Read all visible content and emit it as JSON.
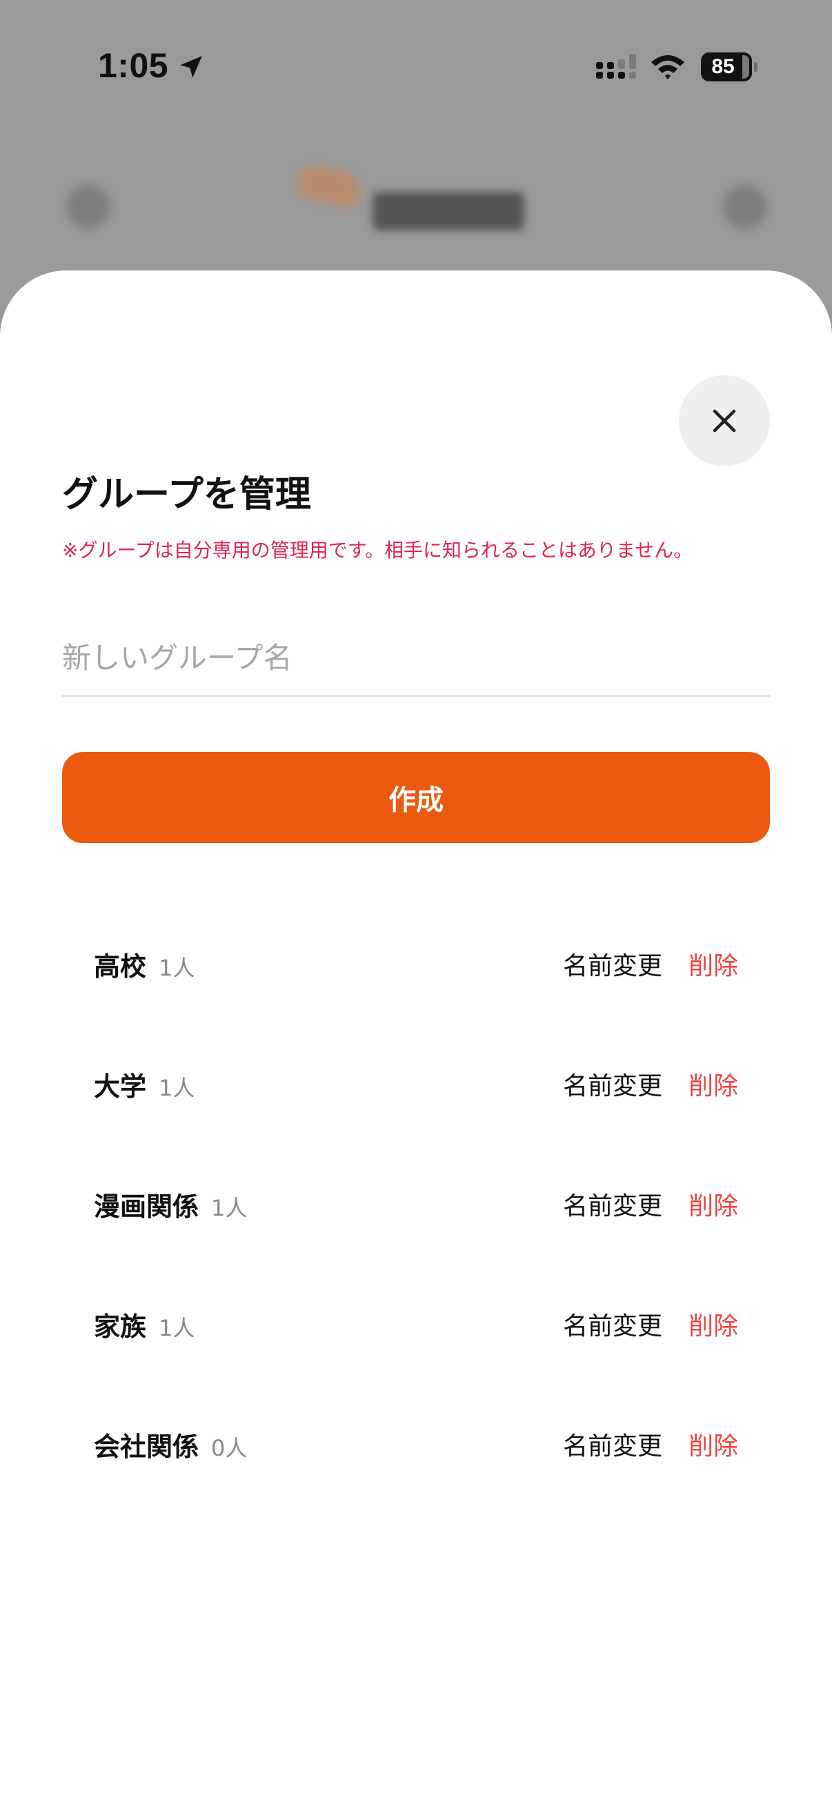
{
  "status_bar": {
    "time": "1:05",
    "battery": "85",
    "icons": [
      "location-arrow-icon",
      "cellular-signal-icon",
      "wifi-icon",
      "battery-icon"
    ]
  },
  "sheet": {
    "title": "グループを管理",
    "note": "※グループは自分専用の管理用です。相手に知られることはありません。",
    "input_placeholder": "新しいグループ名",
    "input_value": "",
    "create_label": "作成",
    "close_icon": "close-icon"
  },
  "groups": [
    {
      "name": "高校",
      "count": "1人",
      "rename": "名前変更",
      "delete": "削除"
    },
    {
      "name": "大学",
      "count": "1人",
      "rename": "名前変更",
      "delete": "削除"
    },
    {
      "name": "漫画関係",
      "count": "1人",
      "rename": "名前変更",
      "delete": "削除"
    },
    {
      "name": "家族",
      "count": "1人",
      "rename": "名前変更",
      "delete": "削除"
    },
    {
      "name": "会社関係",
      "count": "0人",
      "rename": "名前変更",
      "delete": "削除"
    }
  ],
  "colors": {
    "accent": "#eb5a10",
    "note": "#e0254f",
    "delete": "#ef4444",
    "overlay": "#9a9a9a"
  }
}
